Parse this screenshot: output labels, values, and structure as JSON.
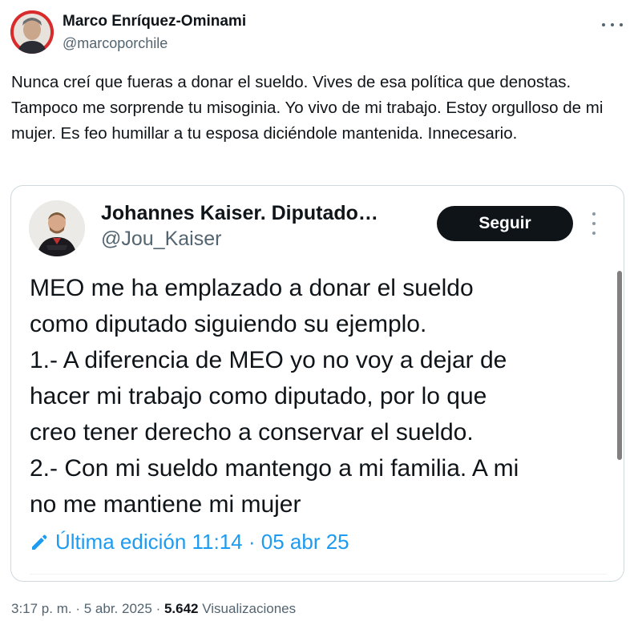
{
  "tweet": {
    "author_name": "Marco Enríquez-Ominami",
    "author_handle": "@marcoporchile",
    "avatar_icon": "profile-photo",
    "more_icon": "more-horizontal-icon",
    "text": "Nunca creí que fueras a donar el sueldo. Vives de esa política que denostas. Tampoco me sorprende tu misoginia. Yo vivo de mi trabajo. Estoy orgulloso de mi mujer. Es feo humillar a tu esposa diciéndole mantenida. Innecesario.",
    "time": "3:17 p. m.",
    "separator": "·",
    "date": "5 abr. 2025",
    "views_count": "5.642",
    "views_label": "Visualizaciones"
  },
  "quoted": {
    "author_name": "Johannes Kaiser. Diputado…",
    "author_handle": "@Jou_Kaiser",
    "follow_label": "Seguir",
    "more_icon": "more-vertical-icon",
    "text": "MEO me ha emplazado a donar el sueldo\ncomo diputado siguiendo su ejemplo.\n1.- A diferencia de MEO yo no voy a dejar de\nhacer mi trabajo como diputado, por lo que\ncreo tener derecho a conservar el sueldo.\n 2.- Con mi sueldo mantengo a mi familia. A mi\nno me mantiene mi mujer",
    "edited_icon": "pencil-icon",
    "edited_label": "Última edición 11:14 · 05 abr 25"
  },
  "colors": {
    "accent": "#1d9bf0",
    "text_primary": "#0f1419",
    "text_secondary": "#536471",
    "border": "#cfd9de",
    "follow_button_bg": "#0f1419"
  }
}
